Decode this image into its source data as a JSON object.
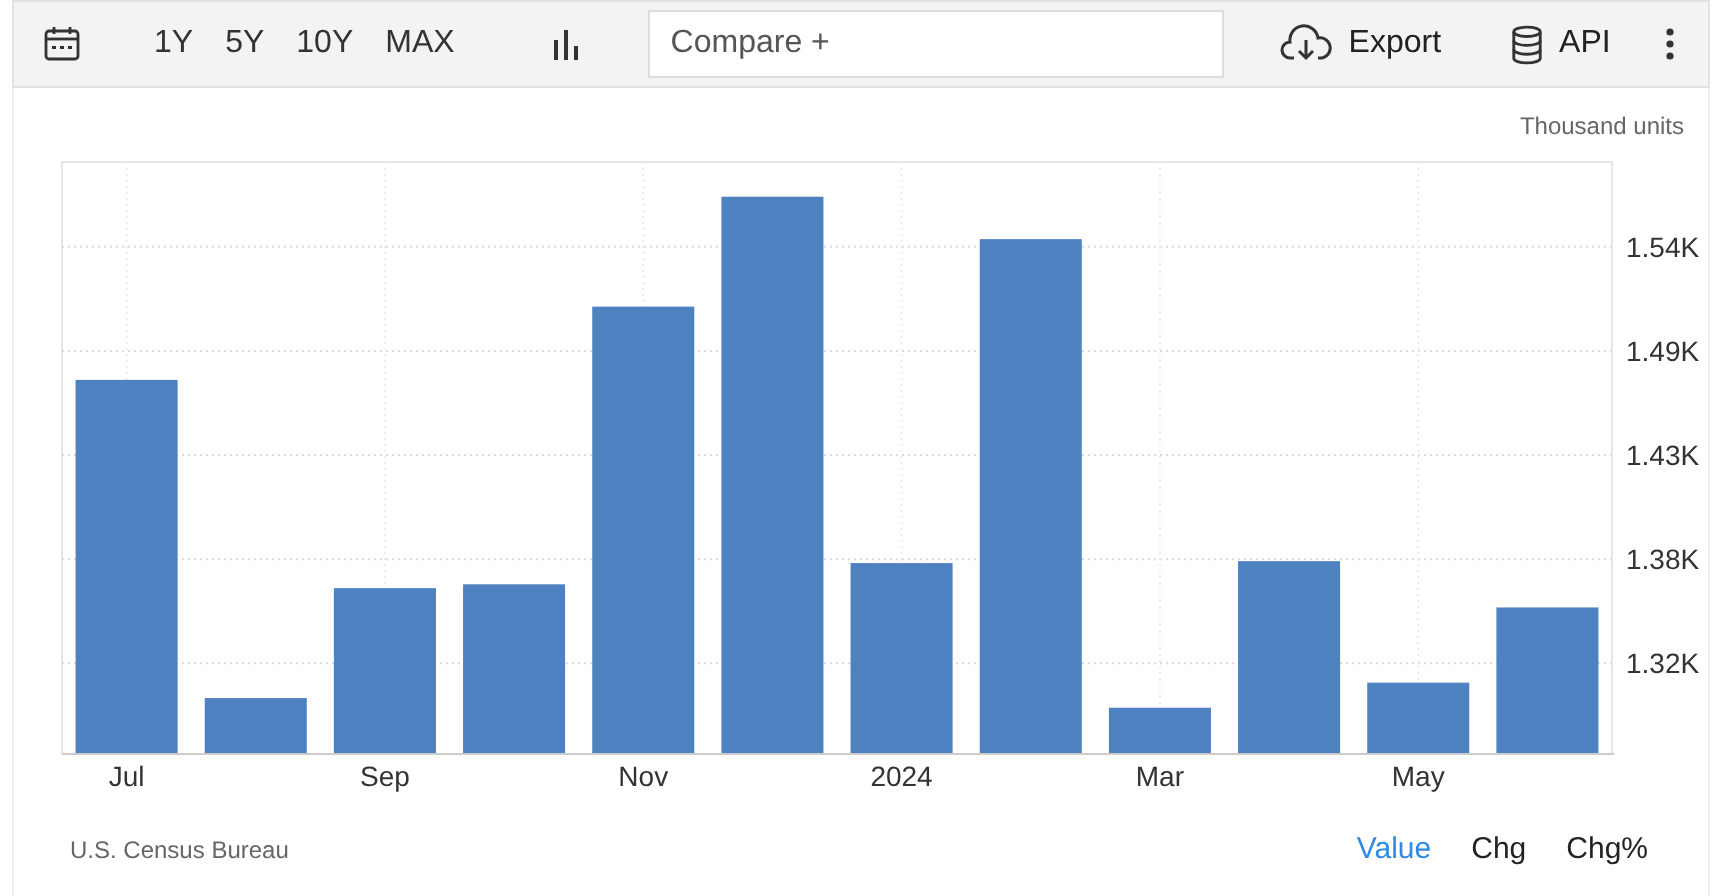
{
  "toolbar": {
    "ranges": [
      {
        "label": "1Y",
        "selected": false
      },
      {
        "label": "5Y",
        "selected": false
      },
      {
        "label": "10Y",
        "selected": false
      },
      {
        "label": "MAX",
        "selected": false
      }
    ],
    "compare": {
      "placeholder": "Compare +"
    },
    "export": "Export",
    "api": "API"
  },
  "chart": {
    "unit": "Thousand units",
    "chart_data": {
      "type": "bar",
      "categories": [
        "Jul",
        null,
        "Sep",
        null,
        "Nov",
        null,
        "2024",
        null,
        "Mar",
        null,
        "May",
        null
      ],
      "values": [
        1.47,
        1.305,
        1.362,
        1.364,
        1.508,
        1.565,
        1.375,
        1.543,
        1.3,
        1.376,
        1.313,
        1.352
      ],
      "ylim": [
        1.276,
        1.583
      ],
      "grid": true,
      "yticks": [
        {
          "value": 1.323,
          "label": "1.32K"
        },
        {
          "value": 1.377,
          "label": "1.38K"
        },
        {
          "value": 1.431,
          "label": "1.43K"
        },
        {
          "value": 1.485,
          "label": "1.49K"
        },
        {
          "value": 1.539,
          "label": "1.54K"
        }
      ]
    }
  },
  "footer": {
    "source": "U.S. Census Bureau",
    "modes": [
      {
        "label": "Value",
        "selected": true
      },
      {
        "label": "Chg",
        "selected": false
      },
      {
        "label": "Chg%",
        "selected": false
      }
    ]
  }
}
